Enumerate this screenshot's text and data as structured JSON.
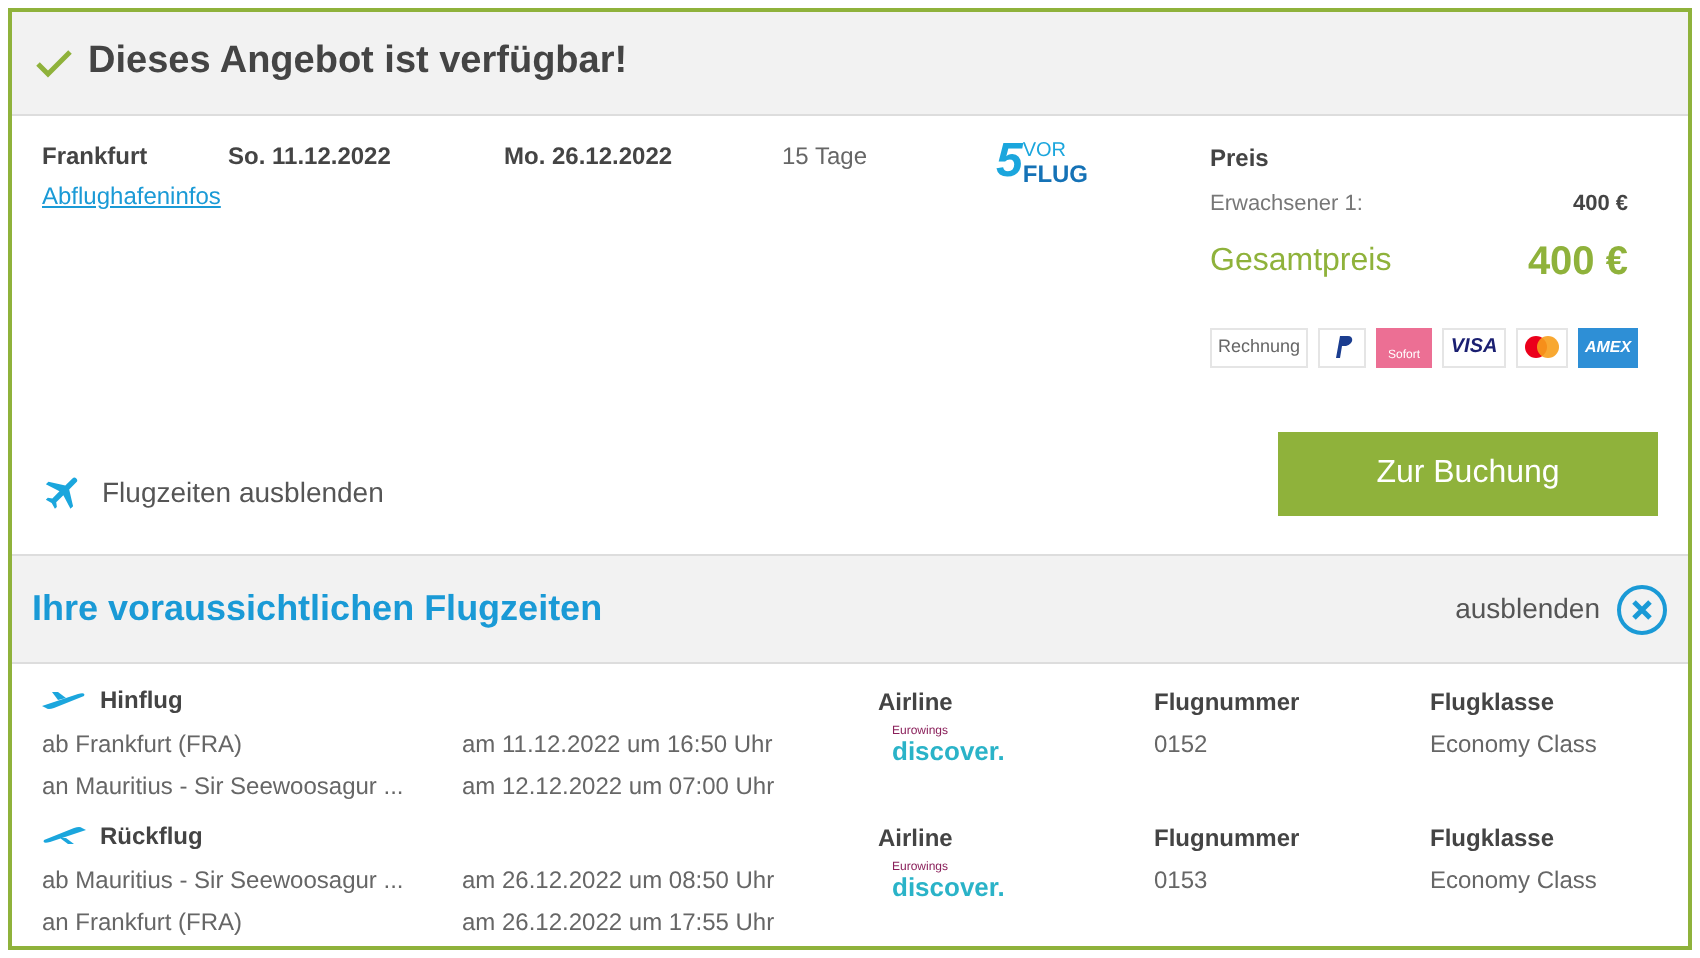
{
  "header": {
    "title": "Dieses Angebot ist verfügbar!"
  },
  "offer": {
    "departure_airport": "Frankfurt",
    "outbound_date": "So. 11.12.2022",
    "return_date": "Mo. 26.12.2022",
    "duration": "15 Tage",
    "airport_info_link": "Abflughafeninfos",
    "operator_logo": {
      "top": "VOR",
      "bottom": "FLUG",
      "digit": "5"
    }
  },
  "price": {
    "heading": "Preis",
    "adult_label": "Erwachsener 1:",
    "adult_price": "400 €",
    "total_label": "Gesamtpreis",
    "total_price": "400 €"
  },
  "payment_methods": [
    {
      "kind": "text",
      "label": "Rechnung"
    },
    {
      "kind": "paypal"
    },
    {
      "kind": "sofort",
      "label": "Sofort"
    },
    {
      "kind": "visa",
      "label": "VISA"
    },
    {
      "kind": "mastercard"
    },
    {
      "kind": "amex",
      "label": "AMEX"
    }
  ],
  "toggle_flight_times": "Flugzeiten ausblenden",
  "book_button": "Zur Buchung",
  "flight_times": {
    "title": "Ihre voraussichtlichen Flugzeiten",
    "hide_label": "ausblenden",
    "legs": [
      {
        "kind": "outbound",
        "title": "Hinflug",
        "from": "ab Frankfurt (FRA)",
        "to": "an Mauritius - Sir Seewoosagur ...",
        "dep_time": "am 11.12.2022 um 16:50 Uhr",
        "arr_time": "am 12.12.2022 um 07:00 Uhr",
        "airline_heading": "Airline",
        "airline_logo": {
          "top": "Eurowings",
          "bottom": "discover."
        },
        "number_heading": "Flugnummer",
        "number": "0152",
        "class_heading": "Flugklasse",
        "class": "Economy Class"
      },
      {
        "kind": "return",
        "title": "Rückflug",
        "from": "ab Mauritius - Sir Seewoosagur ...",
        "to": "an Frankfurt (FRA)",
        "dep_time": "am 26.12.2022 um 08:50 Uhr",
        "arr_time": "am 26.12.2022 um 17:55 Uhr",
        "airline_heading": "Airline",
        "airline_logo": {
          "top": "Eurowings",
          "bottom": "discover."
        },
        "number_heading": "Flugnummer",
        "number": "0153",
        "class_heading": "Flugklasse",
        "class": "Economy Class"
      }
    ]
  }
}
